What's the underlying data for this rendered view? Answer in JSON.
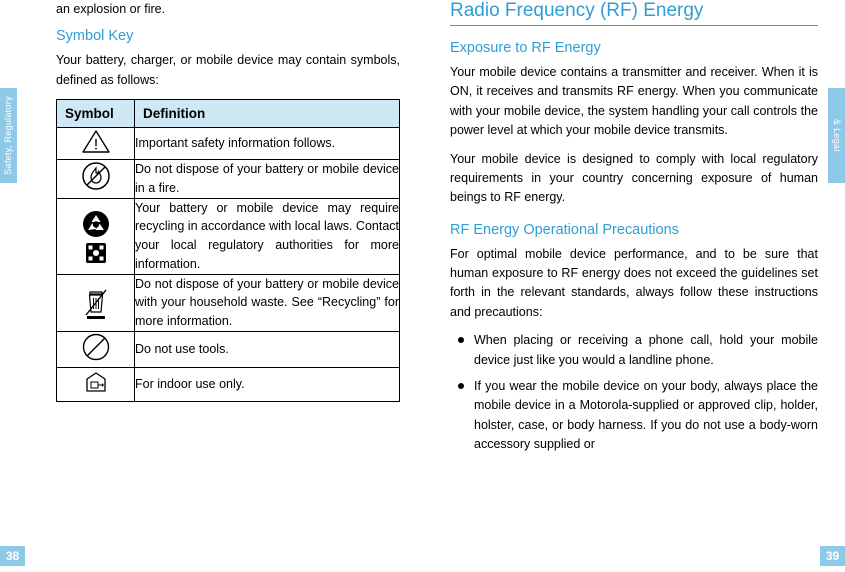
{
  "side_tabs": {
    "left": "Safety, Regulatory",
    "right": "& Legal"
  },
  "folios": {
    "left": "38",
    "right": "39"
  },
  "left_column": {
    "continued_text": "an explosion or fire.",
    "heading": "Symbol Key",
    "intro": "Your battery, charger, or mobile device may contain symbols, defined as follows:",
    "table": {
      "headers": [
        "Symbol",
        "Definition"
      ],
      "rows": [
        {
          "icon": "warning-triangle-icon",
          "definition": "Important safety information follows."
        },
        {
          "icon": "no-fire-icon",
          "definition": "Do not dispose of your battery or mobile device in a fire."
        },
        {
          "icon": "recycle-icon",
          "definition": "Your battery or mobile device may require recycling in accordance with local laws. Contact your local regulatory authorities for more information."
        },
        {
          "icon": "crossed-out-wheelie-bin-icon",
          "definition": "Do not dispose of your battery or mobile device with your household waste. See “Recycling” for more information."
        },
        {
          "icon": "no-tools-icon",
          "definition": "Do not use tools."
        },
        {
          "icon": "indoor-use-icon",
          "definition": "For indoor use only."
        }
      ]
    }
  },
  "right_column": {
    "heading": "Radio Frequency (RF) Energy",
    "sections": [
      {
        "subheading": "Exposure to RF Energy",
        "paragraphs": [
          "Your mobile device contains a transmitter and receiver. When it is ON, it receives and transmits RF energy. When you communicate with your mobile device, the system handling your call controls the power level at which your mobile device transmits.",
          "Your mobile device is designed to comply with local regulatory requirements in your country concerning exposure of human beings to RF energy."
        ]
      },
      {
        "subheading": "RF Energy Operational Precautions",
        "paragraphs": [
          "For optimal mobile device performance, and to be sure that human exposure to RF energy does not exceed the guidelines set forth in the relevant standards, always follow these instructions and precautions:"
        ],
        "bullets": [
          "When placing or receiving a phone call, hold your mobile device just like you would a landline phone.",
          "If you wear the mobile device on your body, always place the mobile device in a Motorola-supplied or approved clip, holder, holster, case, or body harness. If you do not use a body-worn accessory supplied or"
        ]
      }
    ]
  },
  "colors": {
    "accent_blue": "#2e9ed4",
    "tab_blue": "#8ecae8",
    "table_header_fill": "#cfe8f5"
  }
}
